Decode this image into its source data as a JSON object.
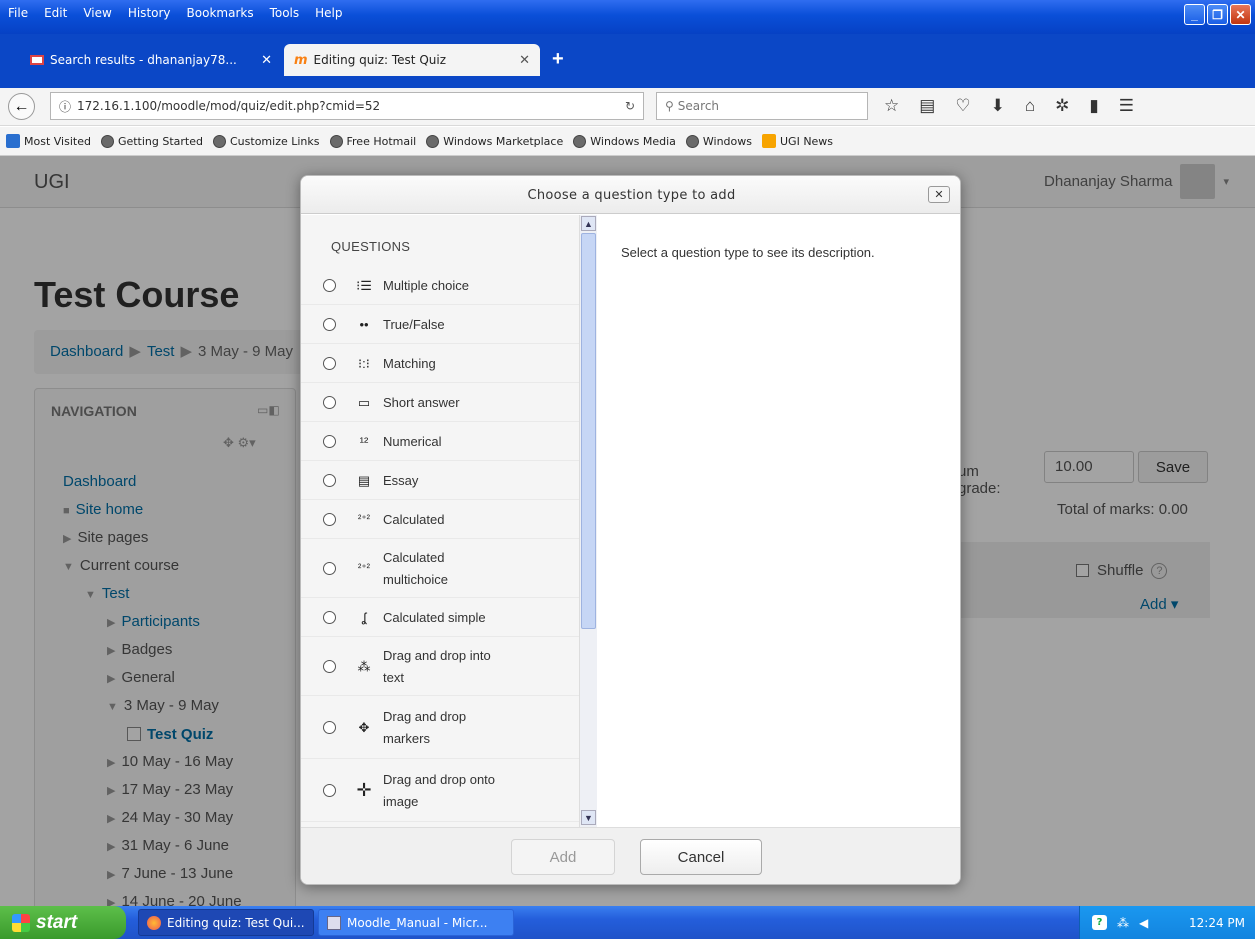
{
  "browser": {
    "menu": [
      "File",
      "Edit",
      "View",
      "History",
      "Bookmarks",
      "Tools",
      "Help"
    ],
    "tabs": [
      {
        "label": "Search results - dhananjay78...",
        "close": "✕"
      },
      {
        "label": "Editing quiz: Test Quiz",
        "close": "✕"
      }
    ],
    "new_tab": "+",
    "url": "172.16.1.100/moodle/mod/quiz/edit.php?cmid=52",
    "search_placeholder": "Search",
    "bookmarks": [
      "Most Visited",
      "Getting Started",
      "Customize Links",
      "Free Hotmail",
      "Windows Marketplace",
      "Windows Media",
      "Windows",
      "UGI News"
    ]
  },
  "moodle": {
    "brand": "UGI",
    "user": "Dhananjay Sharma",
    "course_title": "Test Course",
    "breadcrumb": [
      "Dashboard",
      "Test",
      "3 May - 9 May"
    ],
    "navigation": {
      "title": "NAVIGATION",
      "items": [
        "Dashboard",
        "Site home",
        "Site pages",
        "Current course",
        "Test",
        "Participants",
        "Badges",
        "General",
        "3 May - 9 May",
        "Test Quiz",
        "10 May - 16 May",
        "17 May - 23 May",
        "24 May - 30 May",
        "31 May - 6 June",
        "7 June - 13 June",
        "14 June - 20 June"
      ]
    },
    "grade_label": "um grade:",
    "grade_value": "10.00",
    "save": "Save",
    "total_marks": "Total of marks: 0.00",
    "shuffle": "Shuffle",
    "add_menu": "Add ▾"
  },
  "dialog": {
    "title": "Choose a question type to add",
    "close": "✕",
    "section": "QUESTIONS",
    "description": "Select a question type to see its description.",
    "questions": [
      {
        "label": "Multiple choice",
        "icon": "⁝☰"
      },
      {
        "label": "True/False",
        "icon": "••"
      },
      {
        "label": "Matching",
        "icon": "⁝:⁝"
      },
      {
        "label": "Short answer",
        "icon": "▭"
      },
      {
        "label": "Numerical",
        "icon": "¹²"
      },
      {
        "label": "Essay",
        "icon": "▤"
      },
      {
        "label": "Calculated",
        "icon": "²⁺²"
      },
      {
        "label": "Calculated\nmultichoice",
        "icon": "²⁺²"
      },
      {
        "label": "Calculated simple",
        "icon": "ʆ"
      },
      {
        "label": "Drag and drop into\ntext",
        "icon": "⁂"
      },
      {
        "label": "Drag and drop\nmarkers",
        "icon": "✥"
      },
      {
        "label": "Drag and drop onto\nimage",
        "icon": "✛"
      }
    ],
    "add": "Add",
    "cancel": "Cancel"
  },
  "taskbar": {
    "start": "start",
    "tasks": [
      "Editing quiz: Test Qui...",
      "Moodle_Manual - Micr..."
    ],
    "clock": "12:24 PM"
  }
}
